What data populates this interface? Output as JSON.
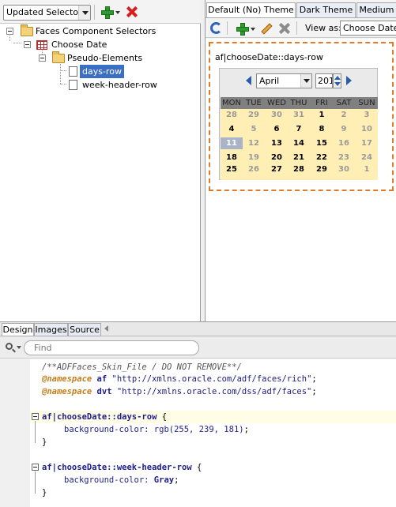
{
  "left_panel": {
    "selector_combo": "Updated Selectors",
    "tree": {
      "root": "Faces Component Selectors",
      "component": "Choose Date",
      "group": "Pseudo-Elements",
      "items": [
        "days-row",
        "week-header-row"
      ]
    }
  },
  "right_panel": {
    "tabs": [
      "Default (No) Theme",
      "Dark Theme",
      "Medium"
    ],
    "view_as_label": "View as:",
    "view_as_value": "Choose Date",
    "preview_label": "af|chooseDate::days-row",
    "calendar": {
      "month": "April",
      "year": "201",
      "weekdays": [
        "MON",
        "TUE",
        "WED",
        "THU",
        "FRI",
        "SAT",
        "SUN"
      ],
      "weeks": [
        [
          "28",
          "29",
          "30",
          "31",
          "1",
          "2",
          "3"
        ],
        [
          "4",
          "5",
          "6",
          "7",
          "8",
          "9",
          "10"
        ],
        [
          "11",
          "12",
          "13",
          "14",
          "15",
          "16",
          "17"
        ],
        [
          "18",
          "19",
          "20",
          "21",
          "22",
          "23",
          "24"
        ],
        [
          "25",
          "26",
          "27",
          "28",
          "29",
          "30",
          "1"
        ]
      ],
      "today": "11"
    }
  },
  "bottom_tabs": [
    "Design",
    "Images",
    "Source"
  ],
  "find": {
    "placeholder": "Find"
  },
  "editor": {
    "comment": "/**ADFFaces_Skin_File / DO NOT REMOVE**/",
    "ns1_kw": "@namespace",
    "ns1_prefix": "af",
    "ns1_uri": "\"http://xmlns.oracle.com/adf/faces/rich\"",
    "ns2_kw": "@namespace",
    "ns2_prefix": "dvt",
    "ns2_uri": "\"http://xmlns.oracle.com/dss/adf/faces\"",
    "rule1_selector": "af|chooseDate::days-row",
    "rule1_property": "background-color:",
    "rule1_value": "rgb(255, 239, 181)",
    "rule2_selector": "af|chooseDate::week-header-row",
    "rule2_property": "background-color:",
    "rule2_value": "Gray",
    "open_brace": "{",
    "close_brace": "}",
    "semicolon": ";"
  },
  "colors": {
    "days_row_bg": "#ffefb5",
    "week_header_bg": "#808080",
    "selection": "#3a6fc4",
    "preview_border": "#e07b2a"
  }
}
